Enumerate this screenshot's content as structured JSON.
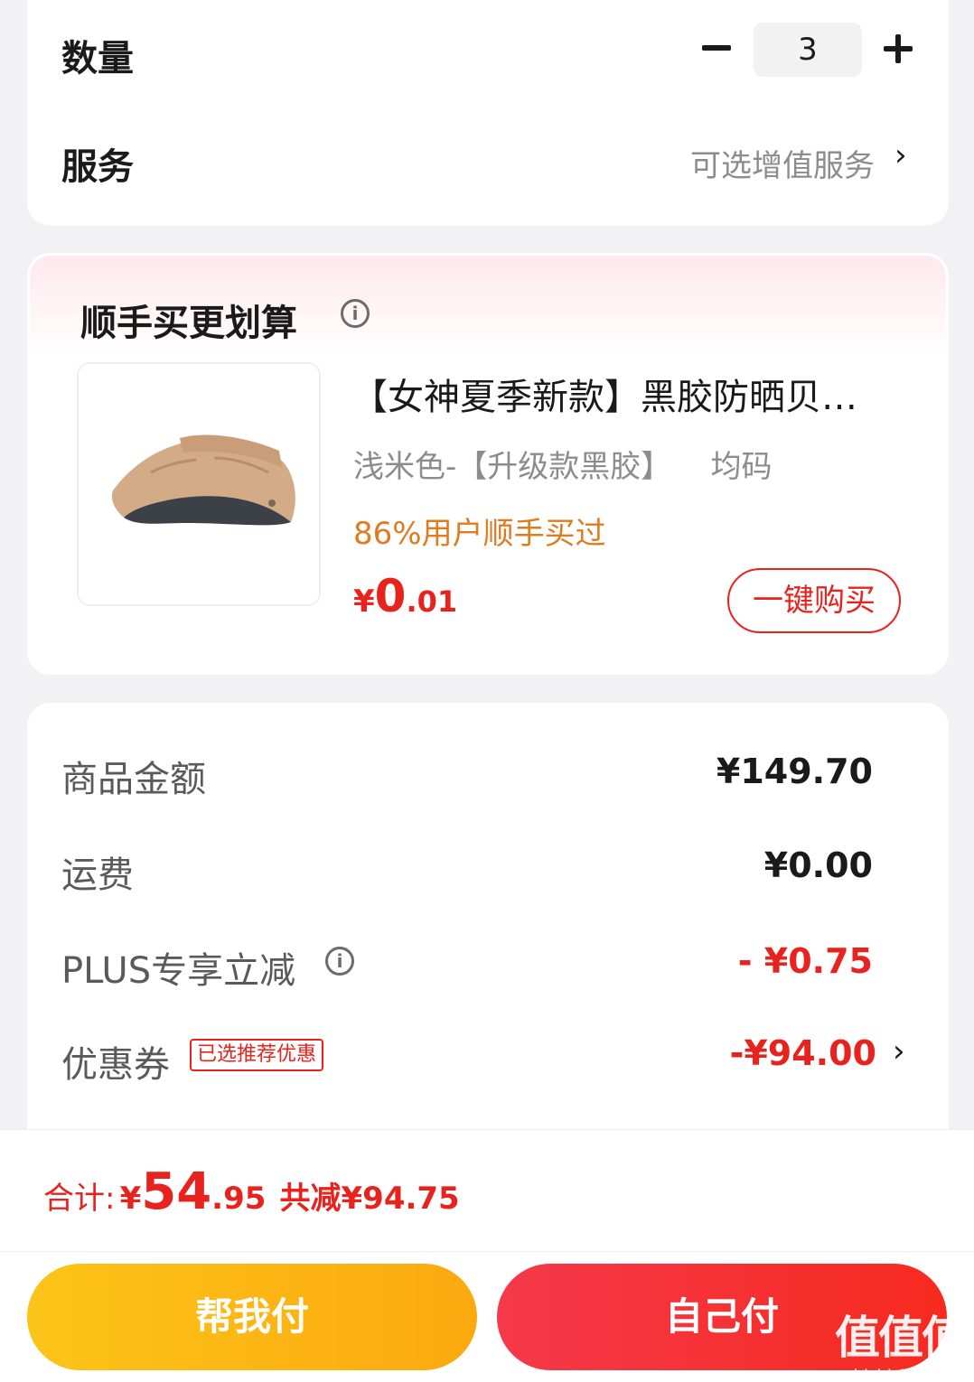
{
  "quantity": {
    "label": "数量",
    "value": "3"
  },
  "service": {
    "label": "服务",
    "value": "可选增值服务"
  },
  "bundle": {
    "title": "顺手买更划算",
    "product": {
      "name": "【女神夏季新款】黑胶防晒贝…",
      "spec": "浅米色-【升级款黑胶】    均码",
      "stat": "86%用户顺手买过",
      "price_currency": "¥",
      "price_int": "0",
      "price_dec": ".01",
      "buy_label": "一键购买"
    }
  },
  "summary": {
    "goods": {
      "label": "商品金额",
      "value": "¥149.70"
    },
    "shipping": {
      "label": "运费",
      "value": "¥0.00"
    },
    "plus": {
      "label": "PLUS专享立减",
      "value": "- ¥0.75"
    },
    "coupon": {
      "label": "优惠券",
      "tag": "已选推荐优惠",
      "value": "-¥94.00"
    }
  },
  "total": {
    "label": "合计:",
    "currency": "¥",
    "int": "54",
    "dec": ".95",
    "saved": "共减¥94.75"
  },
  "buttons": {
    "help_pay": "帮我付",
    "self_pay": "自己付"
  },
  "watermark": {
    "main": "值值值",
    "sub": "zhizhizhi.com"
  },
  "colors": {
    "accent_red": "#e8221d",
    "orange_text": "#e07b20",
    "yellow_button": "#fcc418",
    "red_button": "#f4394a"
  }
}
